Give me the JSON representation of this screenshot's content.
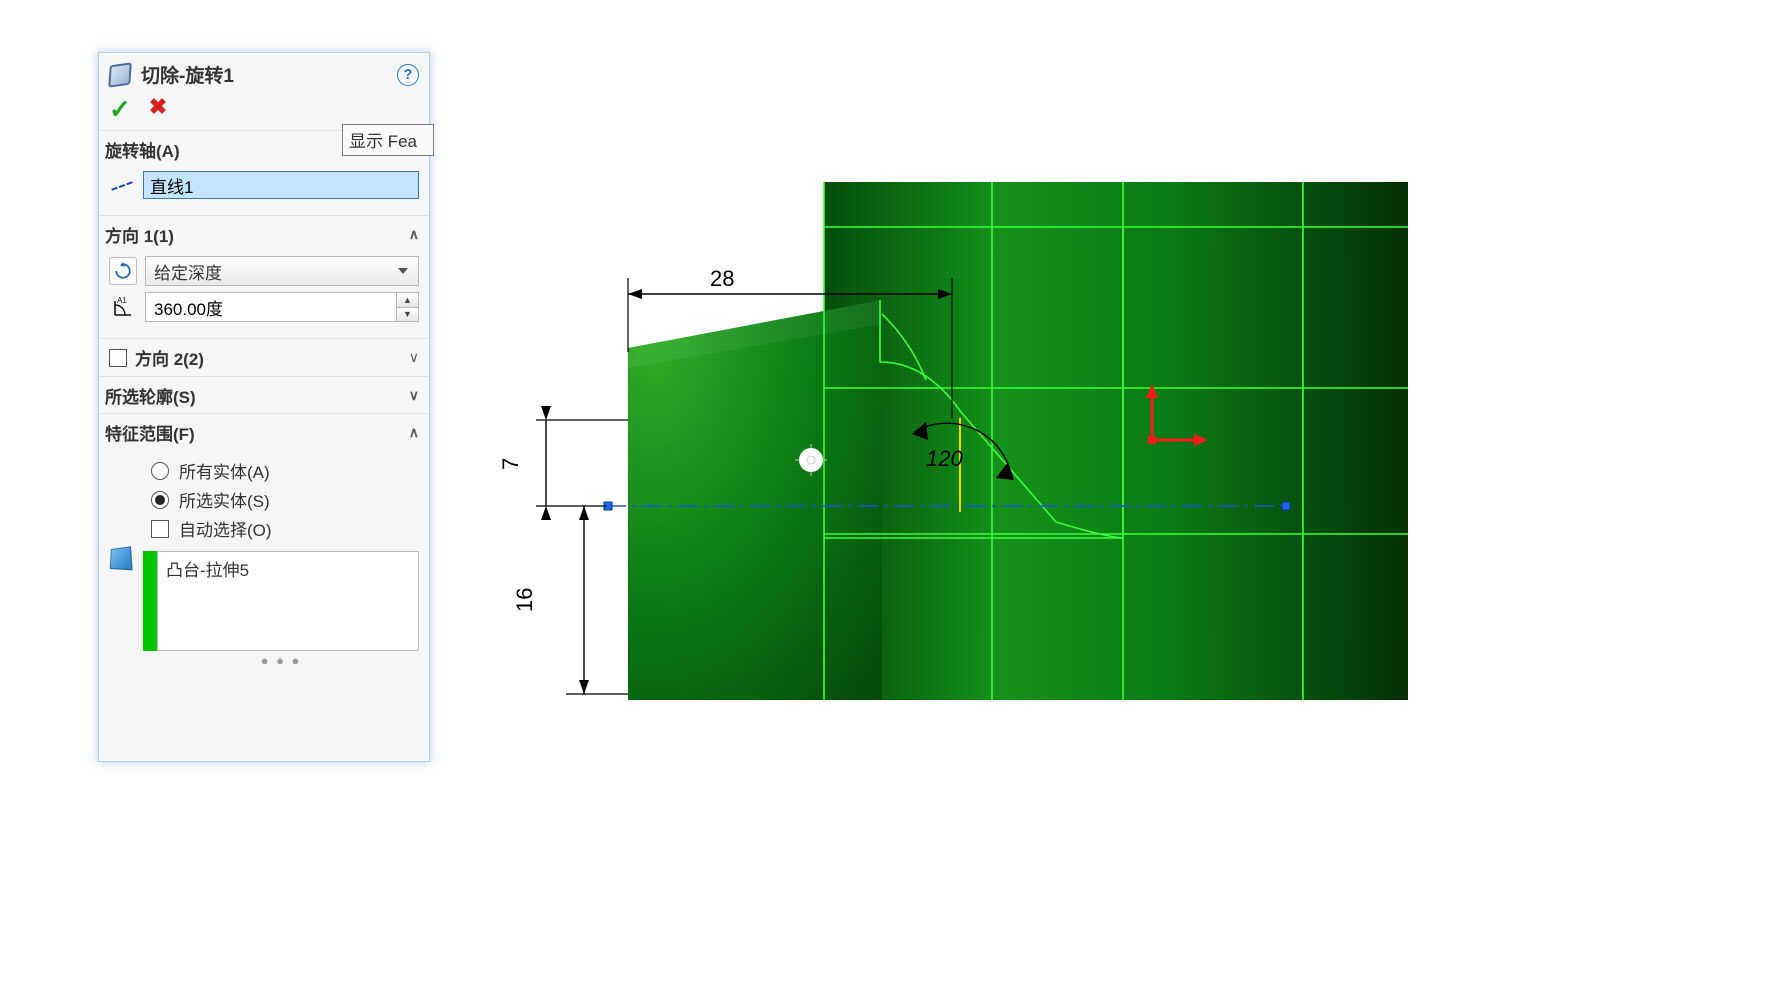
{
  "panel": {
    "title": "切除-旋转1",
    "tooltip": "显示 Fea",
    "sections": {
      "axis": {
        "header": "旋转轴(A)",
        "value": "直线1"
      },
      "dir1": {
        "header": "方向 1(1)",
        "end_condition": "给定深度",
        "angle": "360.00度"
      },
      "dir2": {
        "label": "方向 2(2)"
      },
      "contours": {
        "header": "所选轮廓(S)"
      },
      "scope": {
        "header": "特征范围(F)",
        "opt_all": "所有实体(A)",
        "opt_selected": "所选实体(S)",
        "opt_auto": "自动选择(O)",
        "body_item": "凸台-拉伸5"
      }
    }
  },
  "viewport": {
    "dims": {
      "d28": "28",
      "d7": "7",
      "d16": "16",
      "a120": "120"
    }
  }
}
